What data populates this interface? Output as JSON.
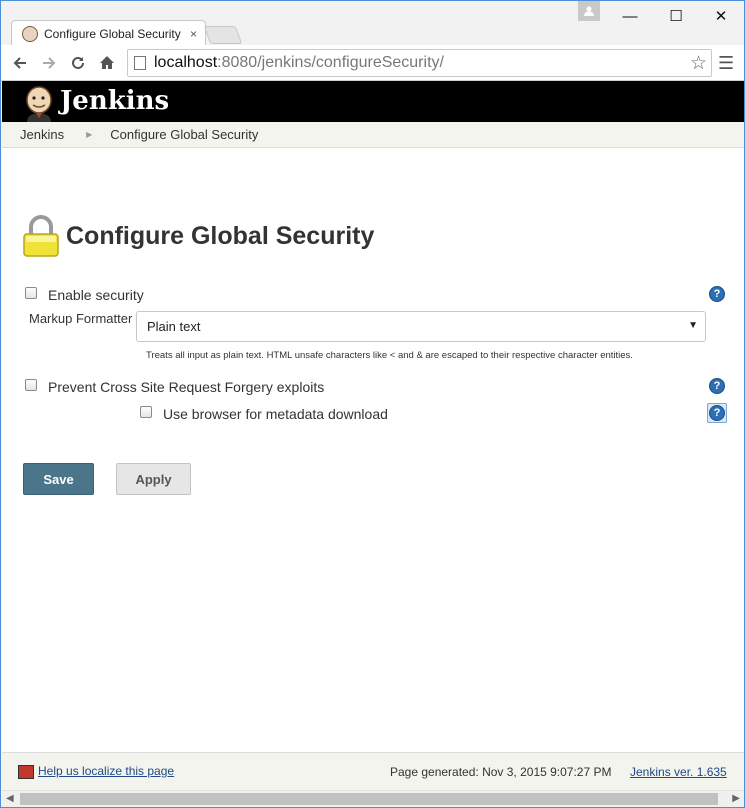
{
  "browser": {
    "tab_title": "Configure Global Security",
    "tab_close": "×",
    "url_host": "localhost",
    "url_path": ":8080/jenkins/configureSecurity/",
    "back_icon": "arrow-left-icon",
    "forward_icon": "arrow-right-icon",
    "reload_icon": "reload-icon",
    "home_icon": "home-icon",
    "bookmark_icon": "star-icon",
    "menu_icon": "hamburger-icon",
    "window_controls": {
      "minimize": "—",
      "maximize": "☐",
      "close": "✕"
    }
  },
  "header": {
    "app_name": "Jenkins"
  },
  "breadcrumbs": {
    "items": [
      "Jenkins",
      "Configure Global Security"
    ],
    "separator": "▶"
  },
  "main": {
    "page_title": "Configure Global Security",
    "enable_security": {
      "label": "Enable security",
      "checked": false
    },
    "markup_formatter": {
      "label": "Markup Formatter",
      "selected": "Plain text",
      "description": "Treats all input as plain text. HTML unsafe characters like < and & are escaped to their respective character entities."
    },
    "csrf": {
      "label": "Prevent Cross Site Request Forgery exploits",
      "checked": false
    },
    "browser_metadata": {
      "label": "Use browser for metadata download",
      "checked": false
    },
    "help_symbol": "?",
    "buttons": {
      "save": "Save",
      "apply": "Apply"
    }
  },
  "footer": {
    "localize_link": "Help us localize this page",
    "generated": "Page generated: Nov 3, 2015 9:07:27 PM",
    "version_link": "Jenkins ver. 1.635"
  },
  "colors": {
    "header_bg": "#000000",
    "save_button": "#4b758b",
    "help_icon": "#2d6fb3",
    "link": "#204a87"
  }
}
